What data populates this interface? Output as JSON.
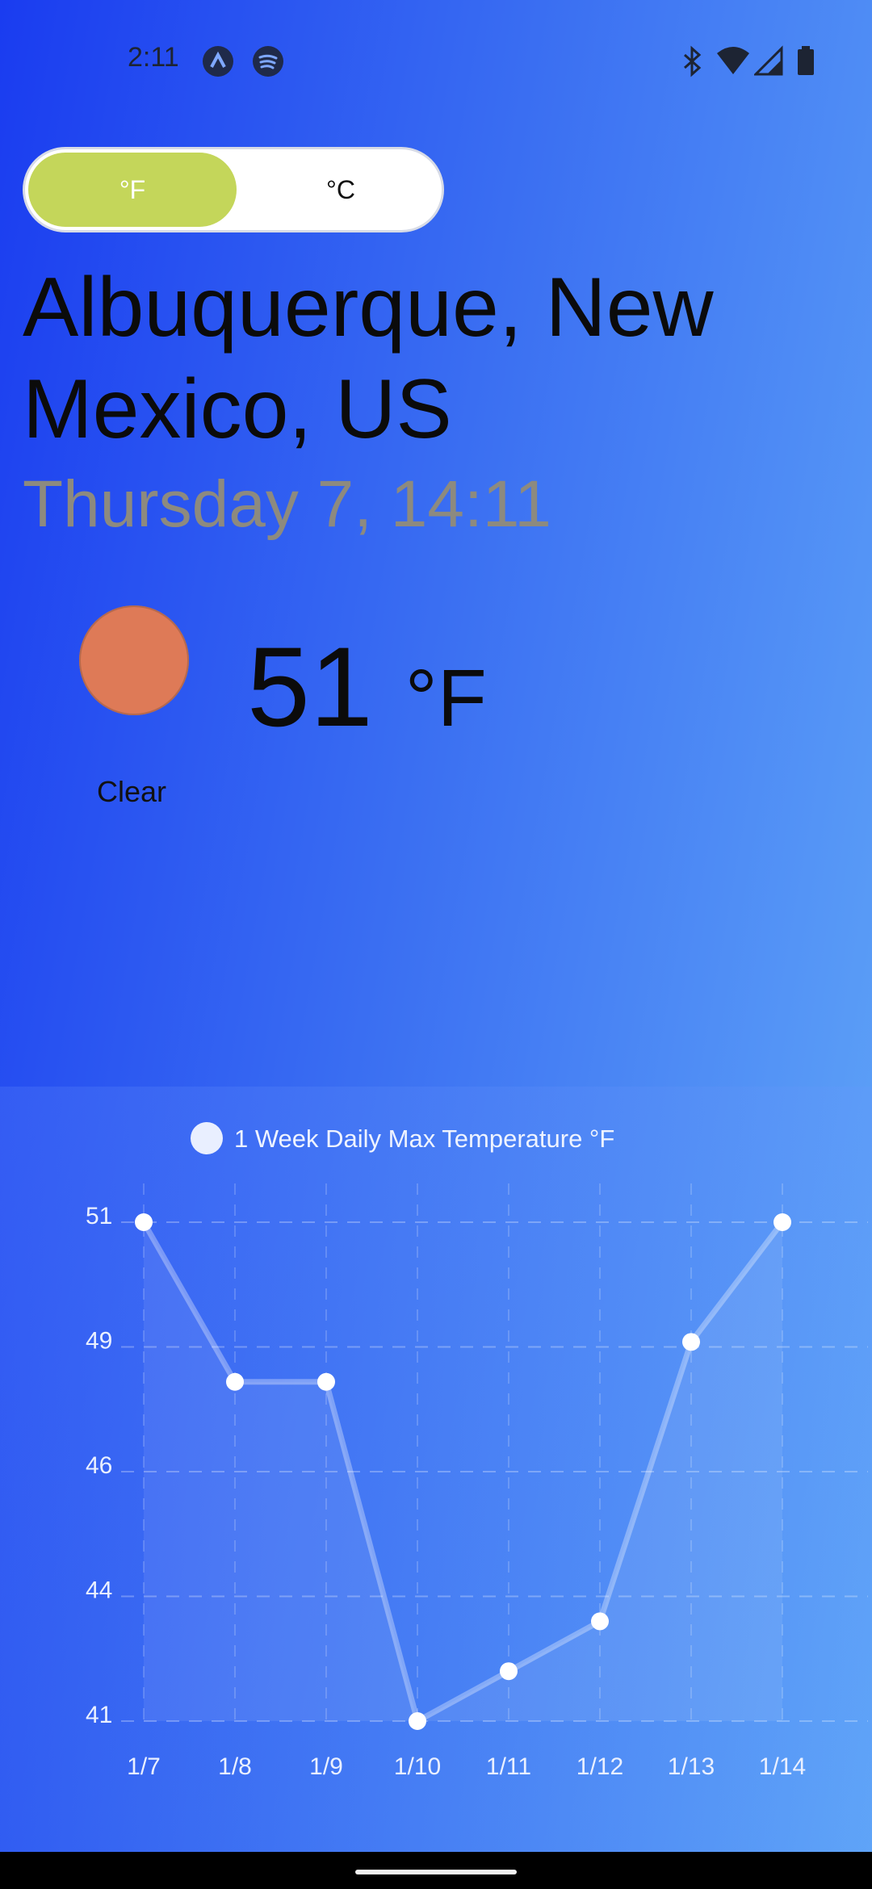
{
  "status_bar": {
    "time": "2:11",
    "icons": [
      "app-a-icon",
      "spotify-icon",
      "bluetooth-icon",
      "wifi-icon",
      "signal-icon",
      "battery-icon"
    ]
  },
  "unit_toggle": {
    "fahrenheit": "°F",
    "celsius": "°C",
    "selected": "°F"
  },
  "location": "Albuquerque, New Mexico, US",
  "datetime": "Thursday 7, 14:11",
  "current": {
    "temp": "51",
    "unit": "°F",
    "condition": "Clear",
    "icon": "sun-icon"
  },
  "colors": {
    "toggle_active": "#c4d65a",
    "sun": "#de7a57"
  },
  "chart_data": {
    "type": "line",
    "title": "1 Week Daily Max Temperature  °F",
    "categories": [
      "1/7",
      "1/8",
      "1/9",
      "1/10",
      "1/11",
      "1/12",
      "1/13",
      "1/14"
    ],
    "series": [
      {
        "values": [
          51,
          47.8,
          47.8,
          41,
          42,
          43,
          48.6,
          51
        ]
      }
    ],
    "y_ticks": [
      "51",
      "49",
      "46",
      "44",
      "41"
    ],
    "ylim": [
      41,
      51
    ],
    "grid": true,
    "legend": "top-center"
  }
}
